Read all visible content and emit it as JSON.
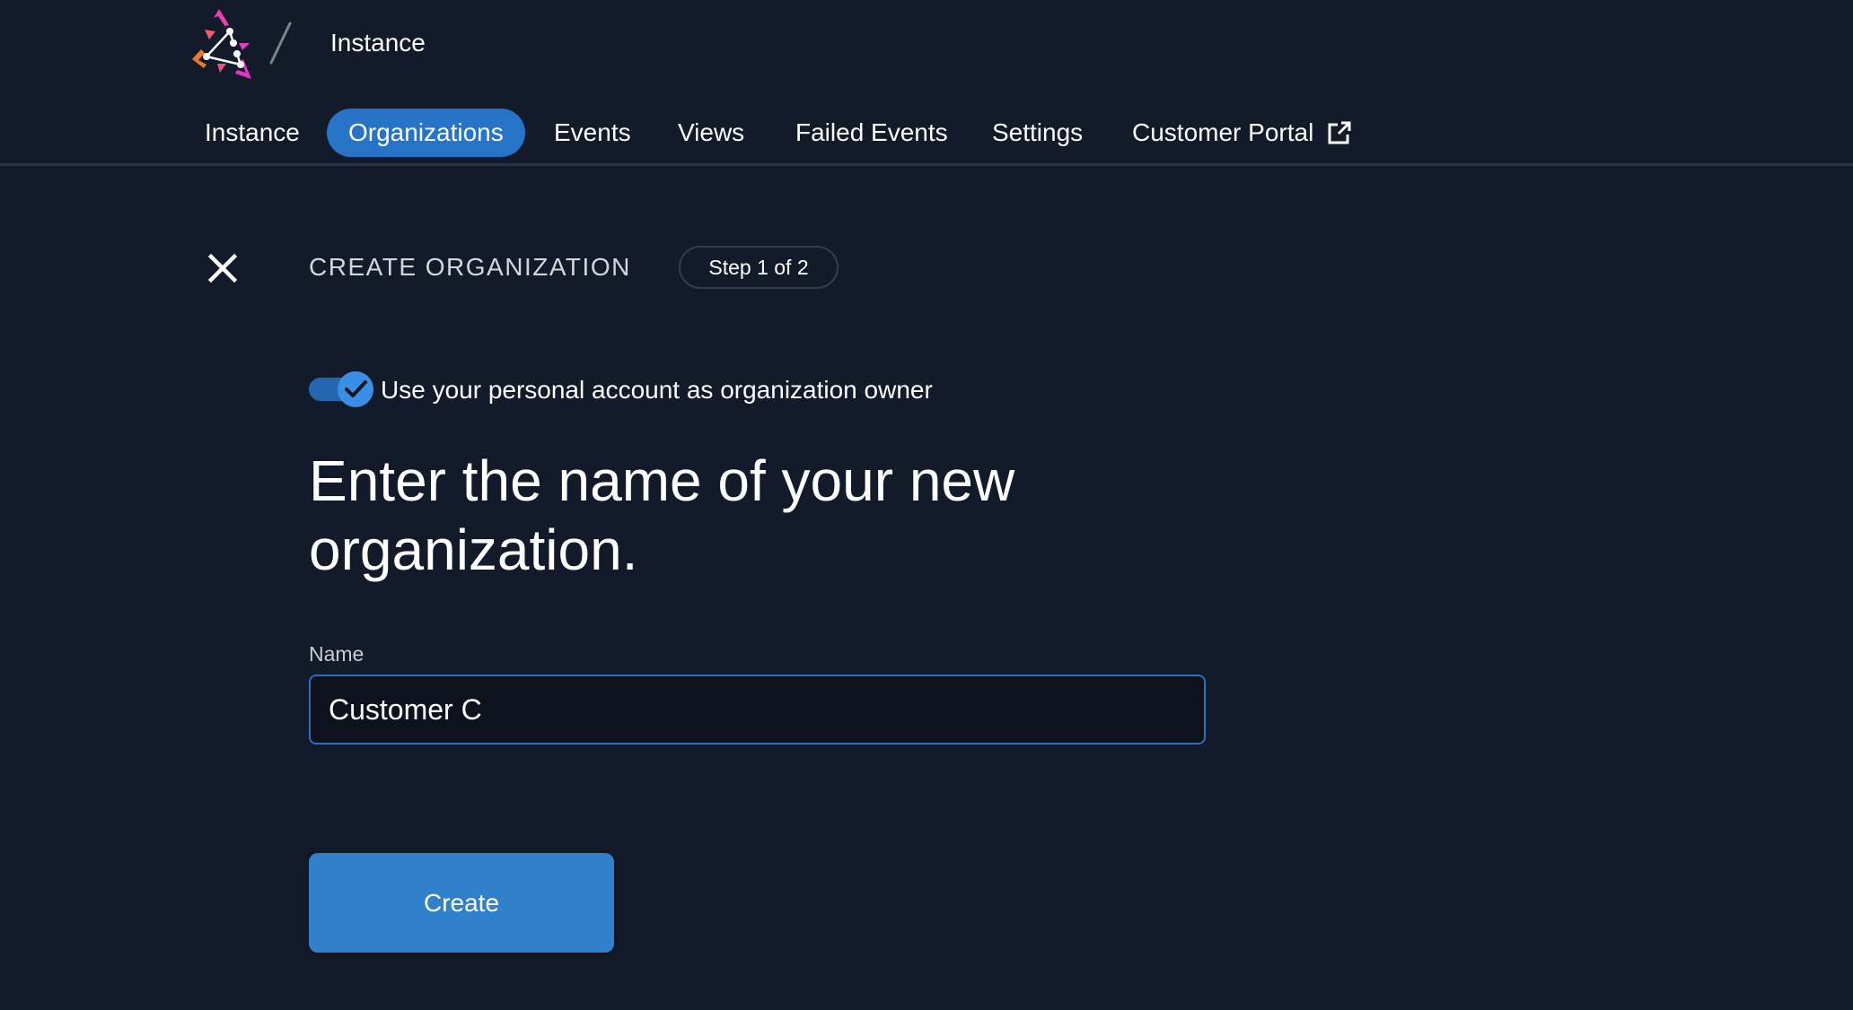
{
  "header": {
    "breadcrumb": "Instance"
  },
  "nav": {
    "items": [
      {
        "label": "Instance",
        "active": false
      },
      {
        "label": "Organizations",
        "active": true
      },
      {
        "label": "Events",
        "active": false
      },
      {
        "label": "Views",
        "active": false
      },
      {
        "label": "Failed Events",
        "active": false
      },
      {
        "label": "Settings",
        "active": false
      },
      {
        "label": "Customer Portal",
        "active": false,
        "icon": "external-link-icon"
      }
    ]
  },
  "dialog": {
    "title": "CREATE ORGANIZATION",
    "step": "Step 1 of 2",
    "close_icon": "close-icon",
    "toggle": {
      "label": "Use your personal account as organization owner",
      "checked": true
    },
    "heading": "Enter the name of your new organization.",
    "name_field": {
      "label": "Name",
      "value": "Customer C",
      "placeholder": ""
    },
    "create_label": "Create"
  },
  "colors": {
    "background": "#131a2a",
    "accent": "#2673c8",
    "button": "#3180cb",
    "input_border": "#2a6fc0"
  }
}
